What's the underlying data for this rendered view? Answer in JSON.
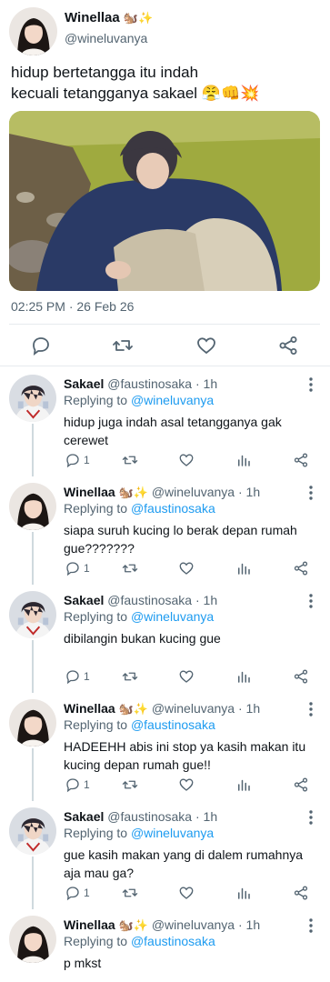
{
  "main_tweet": {
    "author_name": "Winellaa",
    "author_emoji": "🐿️✨",
    "handle": "@wineluvanya",
    "text": "hidup bertetangga itu indah\nkecuali tetangganya sakael 😤👊💥",
    "timestamp": "02:25 PM · 26 Feb 26",
    "icons": [
      "reply-icon",
      "retweet-icon",
      "like-icon",
      "share-icon"
    ]
  },
  "replies": [
    {
      "name": "Sakael",
      "name_emoji": "",
      "handle": "@faustinosaka",
      "time": "1h",
      "replying_label": "Replying to",
      "replying_to": "@wineluvanya",
      "text": "hidup juga indah asal tetangganya gak cerewet",
      "reply_count": "1"
    },
    {
      "name": "Winellaa",
      "name_emoji": "🐿️✨",
      "handle": "@wineluvanya",
      "time": "1h",
      "replying_label": "Replying to",
      "replying_to": "@faustinosaka",
      "text": "siapa suruh kucing lo berak depan rumah gue???????",
      "reply_count": "1"
    },
    {
      "name": "Sakael",
      "name_emoji": "",
      "handle": "@faustinosaka",
      "time": "1h",
      "replying_label": "Replying to",
      "replying_to": "@wineluvanya",
      "text": "dibilangin bukan kucing gue",
      "reply_count": "1"
    },
    {
      "name": "Winellaa",
      "name_emoji": "🐿️✨",
      "handle": "@wineluvanya",
      "time": "1h",
      "replying_label": "Replying to",
      "replying_to": "@faustinosaka",
      "text": "HADEEHH abis ini stop ya kasih makan itu kucing depan rumah gue!!",
      "reply_count": "1"
    },
    {
      "name": "Sakael",
      "name_emoji": "",
      "handle": "@faustinosaka",
      "time": "1h",
      "replying_label": "Replying to",
      "replying_to": "@wineluvanya",
      "text": "gue kasih makan yang di dalem rumahnya aja mau ga?",
      "reply_count": "1"
    },
    {
      "name": "Winellaa",
      "name_emoji": "🐿️✨",
      "handle": "@wineluvanya",
      "time": "1h",
      "replying_label": "Replying to",
      "replying_to": "@faustinosaka",
      "text": "p mkst",
      "reply_count": ""
    }
  ],
  "colors": {
    "text": "#0f1419",
    "secondary": "#536471",
    "accent": "#1d9bf0",
    "divider": "#e7eaee",
    "thread_line": "#cfd9de"
  }
}
